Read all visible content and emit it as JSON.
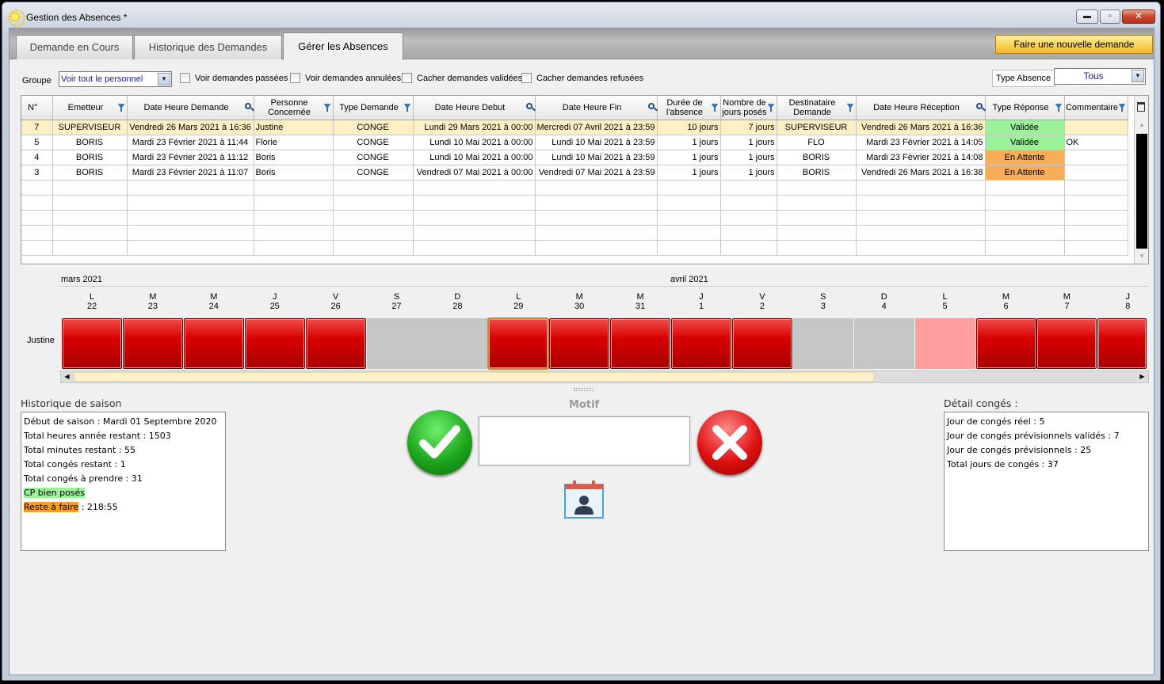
{
  "window": {
    "title": "Gestion des Absences *",
    "min": "▬",
    "max": "▫",
    "close": "✕"
  },
  "tabs": [
    {
      "label": "Demande en Cours"
    },
    {
      "label": "Historique des Demandes"
    },
    {
      "label": "Gérer les Absences"
    }
  ],
  "new_request_label": "Faire une nouvelle demande",
  "filters": {
    "groupe_label": "Groupe",
    "groupe_value": "Voir tout le personnel",
    "dropdown_icon": "▼",
    "checkboxes": [
      "Voir demandes passées",
      "Voir demandes annulées",
      "Cacher demandes validées",
      "Cacher demandes refusées"
    ],
    "type_absence_label": "Type Absence",
    "type_absence_value": "Tous"
  },
  "grid": {
    "columns": [
      "N°",
      "Emetteur",
      "Date Heure Demande",
      "Personne Concernée",
      "Type Demande",
      "Date Heure Debut",
      "Date Heure Fin",
      "Durée de l'absence",
      "Nombre de jours posés",
      "Destinataire Demande",
      "Date Heure Réception",
      "Type Réponse",
      "Commentaire"
    ],
    "rows": [
      [
        "7",
        "SUPERVISEUR",
        "Vendredi 26 Mars 2021 à 16:36",
        "Justine",
        "CONGE",
        "Lundi 29 Mars 2021 à 00:00",
        "Mercredi 07 Avril 2021 à 23:59",
        "10 jours",
        "7 jours",
        "SUPERVISEUR",
        "Vendredi 26 Mars 2021 à 16:36",
        "Validée",
        ""
      ],
      [
        "5",
        "BORIS",
        "Mardi 23 Février 2021 à 11:44",
        "Florie",
        "CONGE",
        "Lundi 10 Mai 2021 à 00:00",
        "Lundi 10 Mai 2021 à 23:59",
        "1 jours",
        "1 jours",
        "FLO",
        "Mardi 23 Février 2021 à 14:05",
        "Validée",
        "OK"
      ],
      [
        "4",
        "BORIS",
        "Mardi 23 Février 2021 à 11:12",
        "Boris",
        "CONGE",
        "Lundi 10 Mai 2021 à 00:00",
        "Lundi 10 Mai 2021 à 23:59",
        "1 jours",
        "1 jours",
        "BORIS",
        "Mardi 23 Février 2021 à 14:08",
        "En Attente",
        ""
      ],
      [
        "3",
        "BORIS",
        "Mardi 23 Février 2021 à 11:07",
        "Boris",
        "CONGE",
        "Vendredi 07 Mai 2021 à 00:00",
        "Vendredi 07 Mai 2021 à 23:59",
        "1 jours",
        "1 jours",
        "BORIS",
        "Vendredi 26 Mars 2021 à 16:38",
        "En Attente",
        ""
      ]
    ]
  },
  "planning": {
    "months": [
      "mars 2021",
      "avril 2021"
    ],
    "person": "Justine",
    "days": [
      [
        "L",
        "22"
      ],
      [
        "M",
        "23"
      ],
      [
        "M",
        "24"
      ],
      [
        "J",
        "25"
      ],
      [
        "V",
        "26"
      ],
      [
        "S",
        "27"
      ],
      [
        "D",
        "28"
      ],
      [
        "L",
        "29"
      ],
      [
        "M",
        "30"
      ],
      [
        "M",
        "31"
      ],
      [
        "J",
        "1"
      ],
      [
        "V",
        "2"
      ],
      [
        "S",
        "3"
      ],
      [
        "D",
        "4"
      ],
      [
        "L",
        "5"
      ],
      [
        "M",
        "6"
      ],
      [
        "M",
        "7"
      ],
      [
        "J",
        "8"
      ]
    ],
    "cells": [
      "abs",
      "abs",
      "abs",
      "abs",
      "abs",
      "we",
      "we",
      "abs today",
      "abs",
      "abs",
      "abs",
      "abs",
      "we",
      "we",
      "light",
      "abs",
      "abs",
      "abs"
    ]
  },
  "historique": {
    "title": "Historique de saison",
    "lines": [
      "Début de saison : Mardi 01 Septembre 2020",
      "Total heures année restant : 1503",
      "Total minutes restant : 55",
      "Total congés restant : 1",
      "Total congés à prendre : 31"
    ],
    "cp_label": "CP bien posés",
    "reste_label": "Reste à faire",
    "reste_value": ":  218:55"
  },
  "motif": {
    "label": "Motif",
    "value": ""
  },
  "detail": {
    "title": "Détail congés :",
    "lines": [
      "Jour de congés réel : 5",
      "Jour de congés prévisionnels validés : 7",
      "Jour de congés prévisionnels : 25",
      "Total jours de congés : 37"
    ]
  }
}
